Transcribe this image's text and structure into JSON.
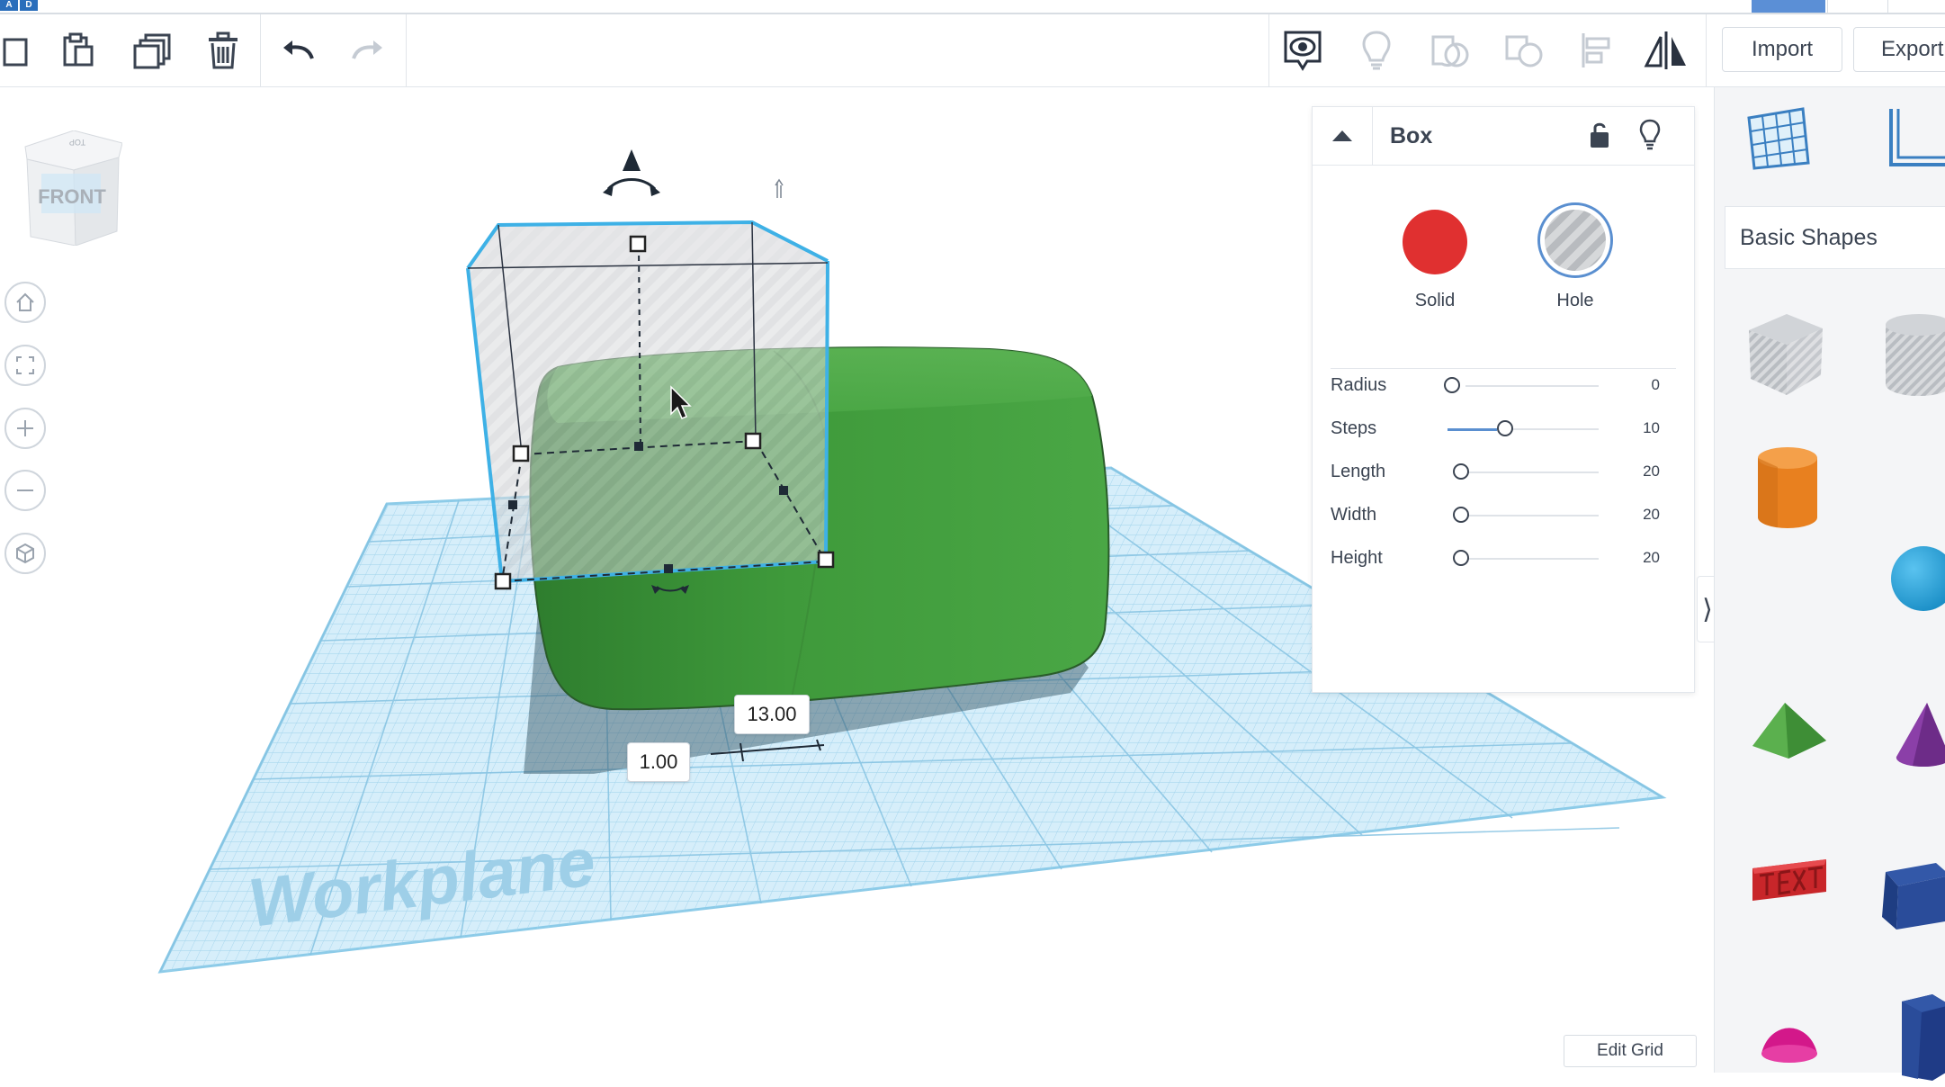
{
  "toolbar": {
    "import_label": "Import",
    "export_label": "Export",
    "tools": [
      "new-shape-icon",
      "paste-icon",
      "duplicate-icon",
      "delete-icon",
      "undo-icon",
      "redo-icon",
      "show-hide-icon",
      "hint-bulb-icon",
      "group-icon",
      "ungroup-icon",
      "align-icon",
      "mirror-icon"
    ]
  },
  "viewcube": {
    "face_label": "FRONT",
    "top_label": "TOP"
  },
  "canvas": {
    "workplane_label": "Workplane",
    "dimension_x": "13.00",
    "dimension_y": "1.00",
    "hole_color": "#b8bbbf",
    "solid_color": "#3e9b3a",
    "grid_color": "#a8d8f0"
  },
  "inspector": {
    "title": "Box",
    "solid_label": "Solid",
    "hole_label": "Hole",
    "solid_color": "#e03030",
    "params": [
      {
        "label": "Radius",
        "value": "0",
        "fraction": 0.0
      },
      {
        "label": "Steps",
        "value": "10",
        "fraction": 0.4
      },
      {
        "label": "Length",
        "value": "20",
        "fraction": 0.07
      },
      {
        "label": "Width",
        "value": "20",
        "fraction": 0.07
      },
      {
        "label": "Height",
        "value": "20",
        "fraction": 0.07
      }
    ]
  },
  "library": {
    "category": "Basic Shapes",
    "items": [
      "box-hole",
      "cylinder-hole",
      "cylinder",
      "sphere",
      "roof",
      "cone",
      "text",
      "box",
      "half-sphere",
      "polygon"
    ]
  },
  "edit_grid_label": "Edit Grid"
}
